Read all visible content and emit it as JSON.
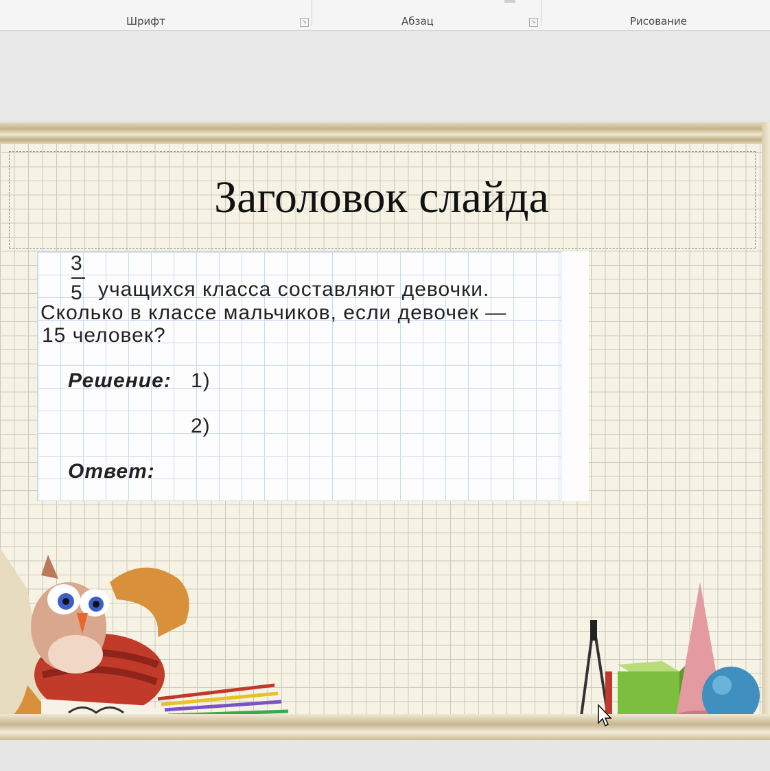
{
  "ribbon": {
    "groups": [
      {
        "label": "Шрифт"
      },
      {
        "label": "Абзац"
      },
      {
        "label": "Рисование"
      }
    ]
  },
  "slide": {
    "title": "Заголовок слайда",
    "task": {
      "fraction_numerator": "3",
      "fraction_denominator": "5",
      "line1": "учащихся класса составляют девочки.",
      "line2": "Сколько в классе мальчиков, если девочек —",
      "line3": "15 человек?",
      "solution_label": "Решение:",
      "step1": "1)",
      "step2": "2)",
      "answer_label": "Ответ:"
    }
  },
  "colors": {
    "slide_background": "#f6f2e4",
    "grid": "#c9c9c0",
    "task_grid": "#c8daf0"
  }
}
